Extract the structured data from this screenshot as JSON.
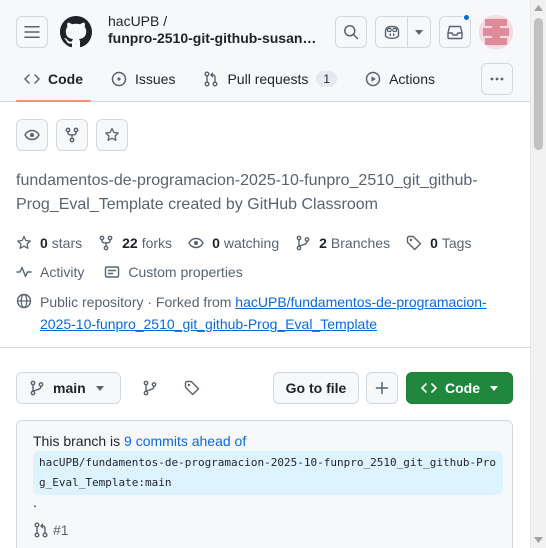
{
  "header": {
    "owner": "hacUPB /",
    "repo_name": "funpro-2510-git-github-susan…",
    "icons": [
      "hamburger-icon",
      "github-logo",
      "search-icon",
      "copilot-icon",
      "chevron-down-icon",
      "inbox-icon",
      "avatar"
    ],
    "notification_color": "#0969da"
  },
  "tabs": [
    {
      "label": "Code",
      "icon": "code-icon",
      "active": true
    },
    {
      "label": "Issues",
      "icon": "issue-icon"
    },
    {
      "label": "Pull requests",
      "icon": "pull-request-icon",
      "count": "1"
    },
    {
      "label": "Actions",
      "icon": "play-icon"
    }
  ],
  "repo": {
    "description": "fundamentos-de-programacion-2025-10-funpro_2510_git_github-Prog_Eval_Template created by GitHub Classroom",
    "stats": {
      "stars_value": "0",
      "stars_label": "stars",
      "forks_value": "22",
      "forks_label": "forks",
      "watching_value": "0",
      "watching_label": "watching",
      "branches_value": "2",
      "branches_label": "Branches",
      "tags_value": "0",
      "tags_label": "Tags"
    },
    "activity_label": "Activity",
    "custom_properties_label": "Custom properties",
    "public_prefix": "Public repository · Forked from ",
    "fork_link": "hacUPB/fundamentos-de-programacion-2025-10-funpro_2510_git_github-Prog_Eval_Template"
  },
  "toolbar": {
    "branch_label": "main",
    "go_to_file_label": "Go to file",
    "code_label": "Code",
    "accent_color": "#1f883d"
  },
  "ahead": {
    "prefix": "This branch is ",
    "link": "9 commits ahead of",
    "ref": "hacUPB/fundamentos-de-programacion-2025-10-funpro_2510_git_github-Prog_Eval_Template:main",
    "period": ".",
    "pr_ref": "#1"
  }
}
